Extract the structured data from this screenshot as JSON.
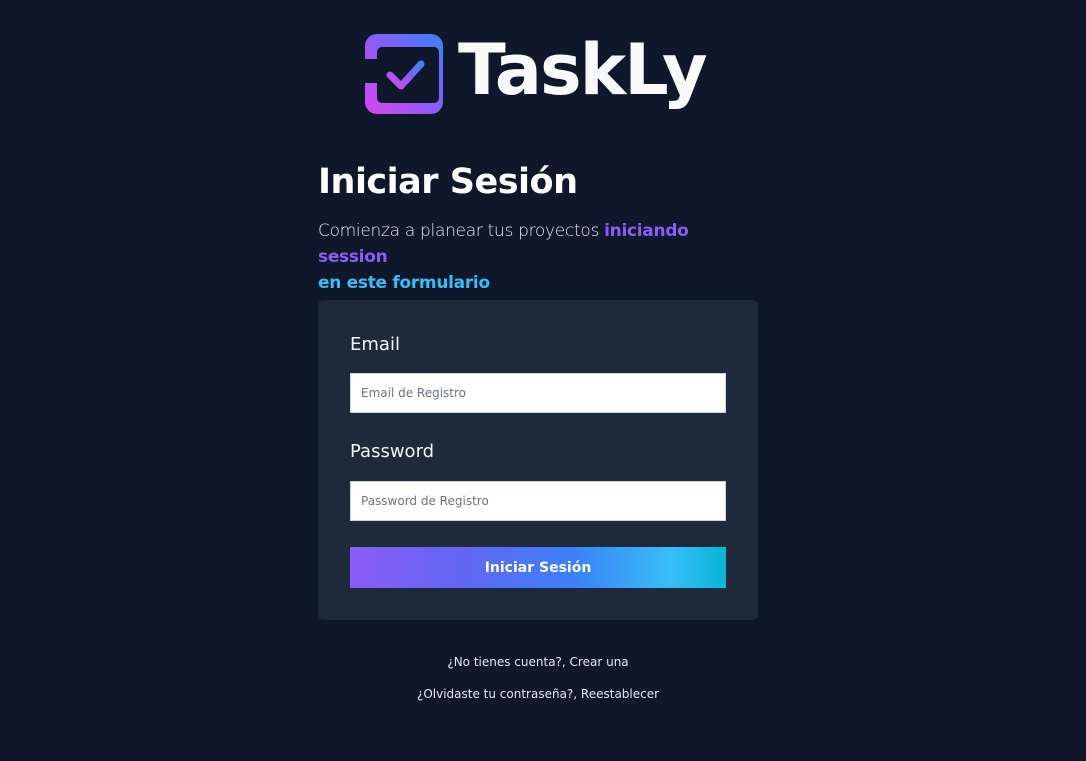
{
  "brand": {
    "name": "TaskLy",
    "logo_icon": "check-square-icon",
    "gradient_start": "#d946ef",
    "gradient_end": "#3b82f6"
  },
  "header": {
    "title": "Iniciar Sesión",
    "subtitle_plain": "Comienza a planear tus proyectos ",
    "subtitle_highlight_1": "iniciando session",
    "subtitle_highlight_2": "en este formulario"
  },
  "form": {
    "email_label": "Email",
    "email_placeholder": "Email de Registro",
    "email_value": "",
    "password_label": "Password",
    "password_placeholder": "Password de Registro",
    "password_value": "",
    "submit_label": "Iniciar Sesión"
  },
  "links": {
    "register": "¿No tienes cuenta?, Crear una",
    "forgot": "¿Olvidaste tu contraseña?, Reestablecer"
  },
  "colors": {
    "background": "#0f172a",
    "card": "#1e293b",
    "accent_purple": "#8b5cf6",
    "accent_cyan": "#06b6d4"
  }
}
